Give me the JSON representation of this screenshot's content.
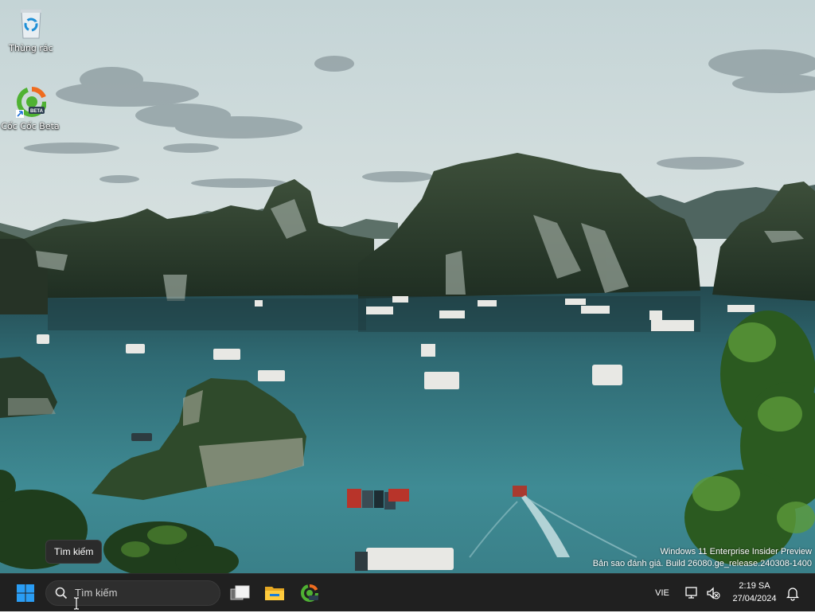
{
  "desktop": {
    "icons": [
      {
        "label": "Thùng rác",
        "icon": "recycle-bin-icon"
      },
      {
        "label": "Cốc Cốc Beta",
        "icon": "coccoc-beta-icon"
      }
    ],
    "watermark": {
      "line1": "Windows 11 Enterprise Insider Preview",
      "line2": "Bản sao đánh giá. Build 26080.ge_release.240308-1400"
    },
    "tooltip": "Tìm kiếm"
  },
  "taskbar": {
    "start_icon": "windows-start-icon",
    "search_placeholder": "Tìm kiếm",
    "apps": [
      {
        "name": "Task View",
        "icon": "task-view-icon"
      },
      {
        "name": "File Explorer",
        "icon": "file-explorer-icon"
      },
      {
        "name": "Cốc Cốc Beta",
        "icon": "coccoc-icon"
      }
    ],
    "language": "VIE",
    "time": "2:19 SA",
    "date": "27/04/2024"
  },
  "colors": {
    "taskbar_bg": "#202020",
    "start_blue": "#2a9df4",
    "coccoc_green": "#4fb233",
    "coccoc_orange": "#ef6c1f"
  }
}
